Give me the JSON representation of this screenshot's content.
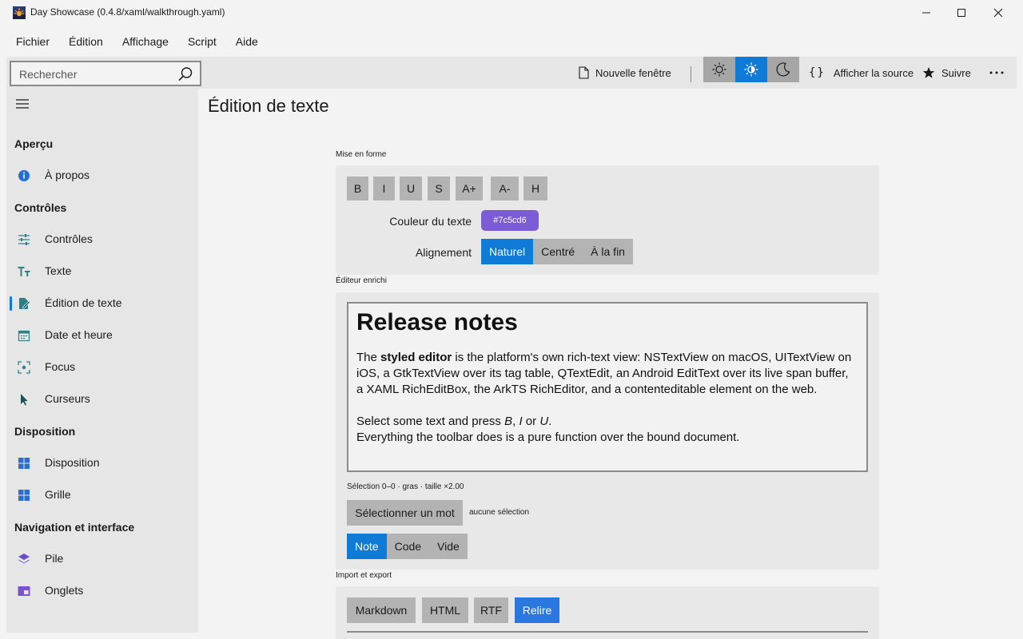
{
  "window": {
    "title": "Day Showcase (0.4.8/xaml/walkthrough.yaml)"
  },
  "menu": [
    "Fichier",
    "Édition",
    "Affichage",
    "Script",
    "Aide"
  ],
  "toolbar": {
    "search_placeholder": "Rechercher",
    "new_window": "Nouvelle fenêtre",
    "show_source": "Afficher la source",
    "follow": "Suivre"
  },
  "sidebar": {
    "sections": [
      {
        "title": "Aperçu",
        "items": [
          {
            "label": "À propos",
            "icon": "info-icon"
          }
        ]
      },
      {
        "title": "Contrôles",
        "items": [
          {
            "label": "Contrôles",
            "icon": "sliders-icon"
          },
          {
            "label": "Texte",
            "icon": "text-icon"
          },
          {
            "label": "Édition de texte",
            "icon": "edit-document-icon"
          },
          {
            "label": "Date et heure",
            "icon": "calendar-icon"
          },
          {
            "label": "Focus",
            "icon": "focus-icon"
          },
          {
            "label": "Curseurs",
            "icon": "cursor-icon"
          }
        ]
      },
      {
        "title": "Disposition",
        "items": [
          {
            "label": "Disposition",
            "icon": "layout-icon"
          },
          {
            "label": "Grille",
            "icon": "grid-icon"
          }
        ]
      },
      {
        "title": "Navigation et interface",
        "items": [
          {
            "label": "Pile",
            "icon": "stack-icon"
          },
          {
            "label": "Onglets",
            "icon": "tabs-icon"
          }
        ]
      }
    ]
  },
  "main": {
    "title": "Édition de texte",
    "formatting": {
      "label": "Mise en forme",
      "buttons": [
        "B",
        "I",
        "U",
        "S",
        "A+",
        "A-",
        "H"
      ],
      "color_label": "Couleur du texte",
      "color_value": "#7c5cd6",
      "align_label": "Alignement",
      "align_options": [
        "Naturel",
        "Centré",
        "À la fin"
      ],
      "align_selected": "Naturel"
    },
    "rich_editor": {
      "label": "Éditeur enrichi",
      "heading": "Release notes",
      "p1_a": "The ",
      "p1_bold": "styled editor",
      "p1_b": " is the platform's own rich-text view: NSTextView on macOS, UITextView on iOS, a GtkTextView over its tag table, QTextEdit, an Android EditText over its live span buffer, a XAML RichEditBox, the ArkTS RichEditor, and a contenteditable element on the web.",
      "p2_a": "Select some text and press ",
      "p2_b": "B",
      "p2_c": ", ",
      "p2_d": "I",
      "p2_e": " or ",
      "p2_f": "U",
      "p2_g": ".",
      "p3": "Everything the toolbar does is a pure function over the bound document.",
      "selection_status": "Sélection 0–0 · gras · taille ×2.00",
      "select_word": "Sélectionner un mot",
      "no_selection": "aucune sélection",
      "presets": [
        "Note",
        "Code",
        "Vide"
      ],
      "preset_selected": "Note"
    },
    "import_export": {
      "label": "Import et export",
      "buttons": [
        "Markdown",
        "HTML",
        "RTF"
      ],
      "reread": "Relire"
    }
  },
  "colors": {
    "accent": "#0f7bd7",
    "text_color": "#7c5cd6",
    "reread": "#2a77e0"
  }
}
